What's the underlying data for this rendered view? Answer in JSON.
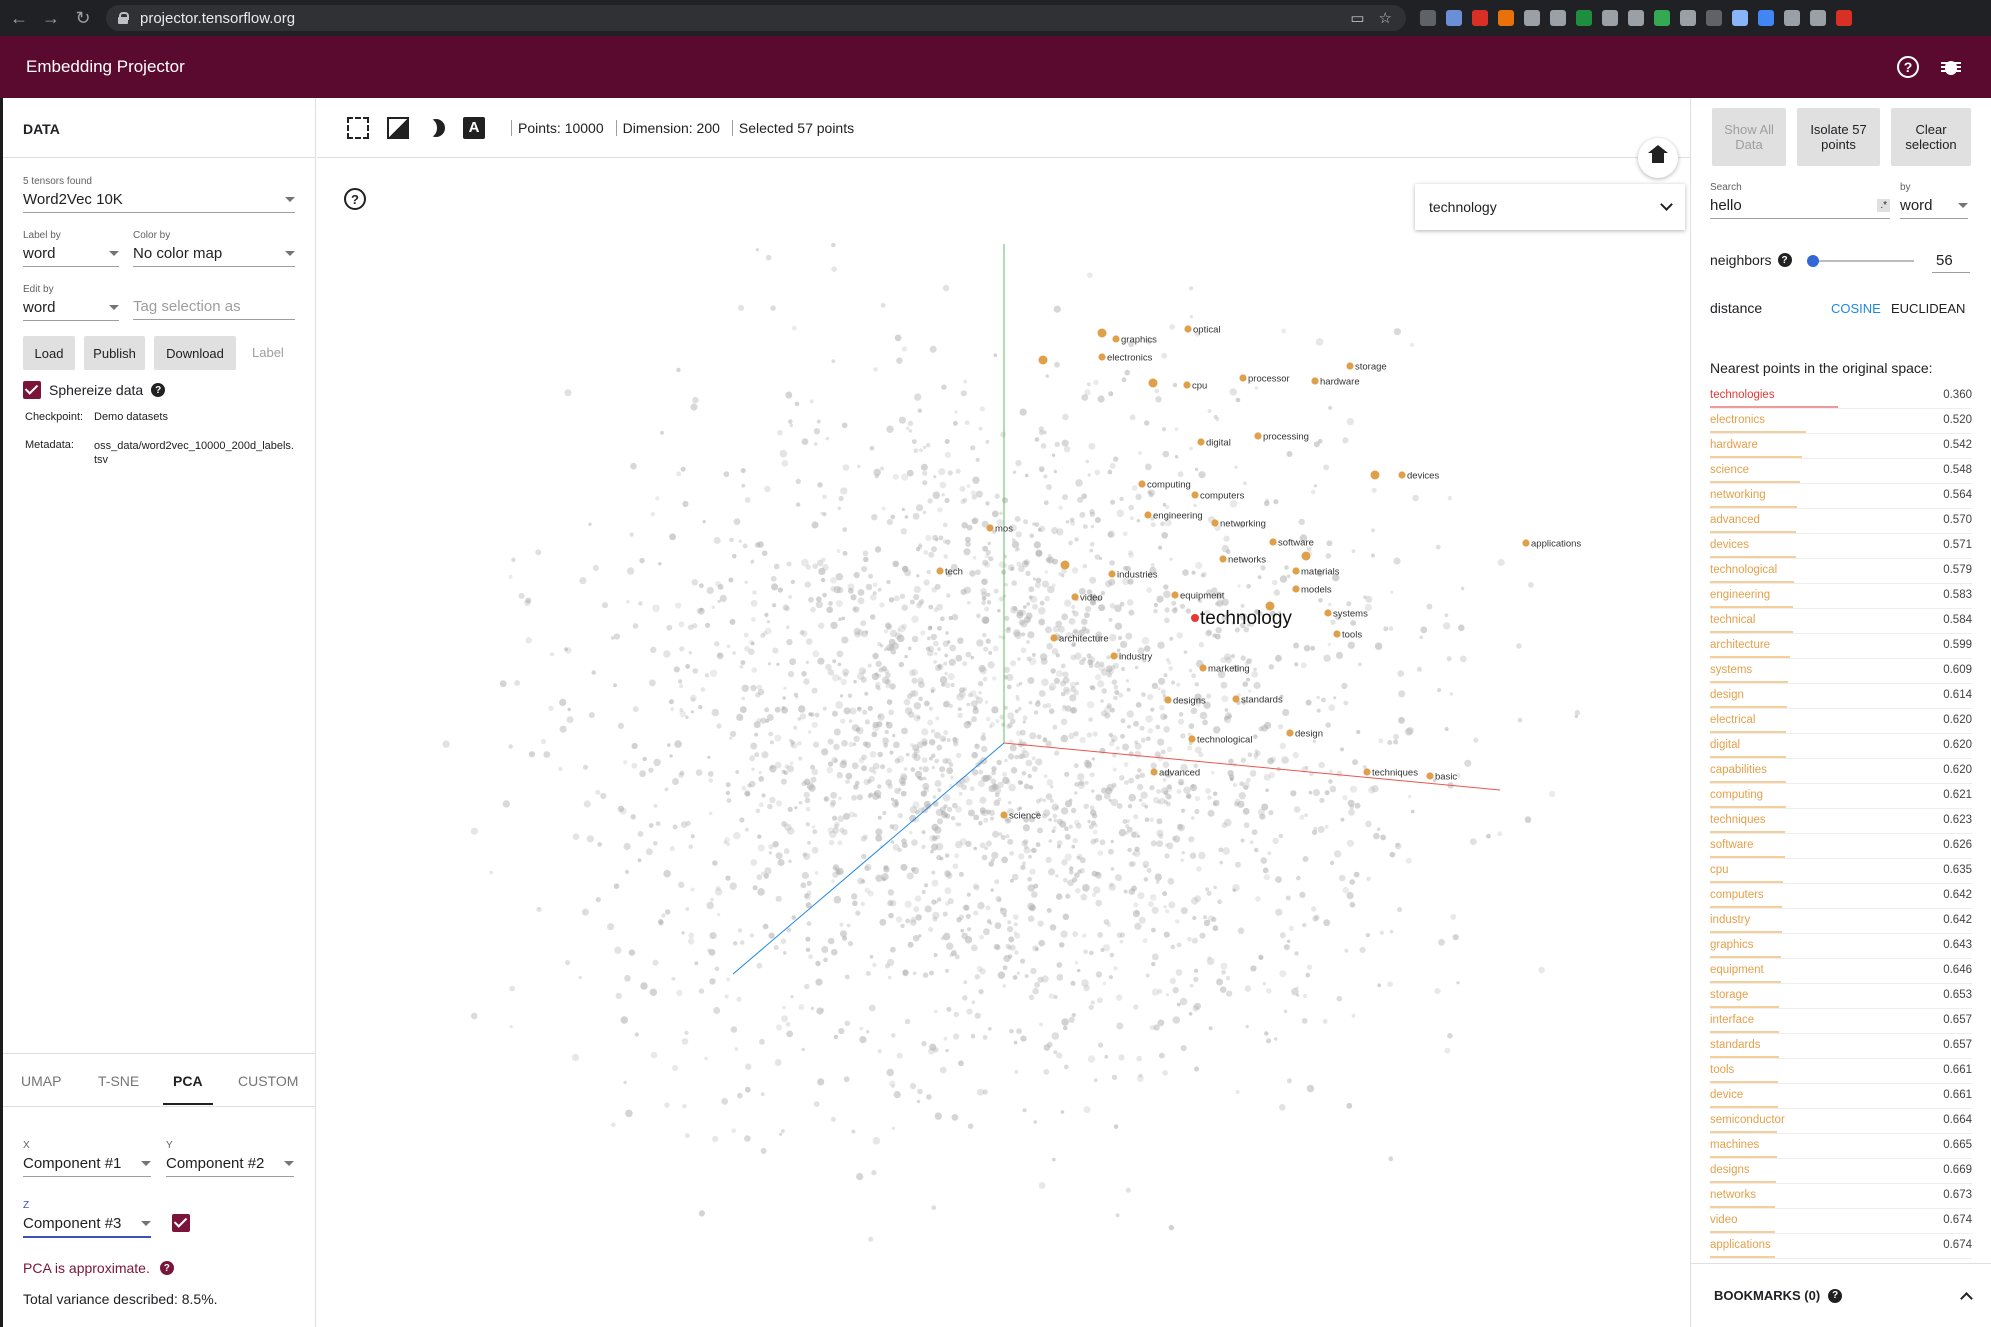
{
  "browser": {
    "url": "projector.tensorflow.org",
    "extension_colors": [
      "#5f6368",
      "#6b8fd6",
      "#d93025",
      "#e8710a",
      "#9aa0a6",
      "#9aa0a6",
      "#1e8e3e",
      "#9aa0a6",
      "#9aa0a6",
      "#34a853",
      "#9aa0a6",
      "#5f6368",
      "#8ab4f8",
      "#4285f4",
      "#9aa0a6",
      "#9aa0a6",
      "#d93025"
    ]
  },
  "header": {
    "title": "Embedding Projector"
  },
  "data_panel": {
    "title": "DATA",
    "tensors_label": "5 tensors found",
    "tensor": "Word2Vec 10K",
    "label_by_label": "Label by",
    "label_by": "word",
    "color_by_label": "Color by",
    "color_by": "No color map",
    "edit_by_label": "Edit by",
    "edit_by": "word",
    "tag_placeholder": "Tag selection as",
    "load": "Load",
    "publish": "Publish",
    "download": "Download",
    "label_btn": "Label",
    "sphereize": "Sphereize data",
    "checkpoint_key": "Checkpoint:",
    "checkpoint_val": "Demo datasets",
    "metadata_key": "Metadata:",
    "metadata_val": "oss_data/word2vec_10000_200d_labels.tsv"
  },
  "projection": {
    "tabs": [
      "UMAP",
      "T-SNE",
      "PCA",
      "CUSTOM"
    ],
    "active_tab": "PCA",
    "x_label": "X",
    "x_value": "Component #1",
    "y_label": "Y",
    "y_value": "Component #2",
    "z_label": "Z",
    "z_value": "Component #3",
    "approx_note": "PCA is approximate.",
    "variance": "Total variance described: 8.5%."
  },
  "toolbar": {
    "points": "Points: 10000",
    "dimension": "Dimension: 200",
    "selected": "Selected 57 points",
    "label_select": "technology"
  },
  "scatter": {
    "query_label": "technology",
    "query_color": "#e53935",
    "neighbor_color": "#e0a04a",
    "background_point_color": "#b0b0b0",
    "axis_colors": {
      "x": "#ef5350",
      "y": "#66bb6a",
      "z": "#1e88e5"
    },
    "labels": [
      "graphics",
      "optical",
      "electronics",
      "storage",
      "processor",
      "cpu",
      "hardware",
      "digital",
      "processing",
      "devices",
      "computing",
      "computers",
      "applications",
      "engineering",
      "networking",
      "mos",
      "software",
      "networks",
      "tech",
      "industries",
      "materials",
      "video",
      "equipment",
      "models",
      "systems",
      "architecture",
      "tools",
      "industry",
      "marketing",
      "designs",
      "standards",
      "technological",
      "design",
      "advanced",
      "techniques",
      "basic",
      "science"
    ]
  },
  "inspector": {
    "show_all": "Show All Data",
    "isolate": "Isolate 57 points",
    "clear": "Clear selection",
    "search_label": "Search",
    "search_value": "hello",
    "regex": ".*",
    "by_label": "by",
    "by_value": "word",
    "neighbors_label": "neighbors",
    "neighbors": "56",
    "neighbors_fraction": 0.01,
    "distance_label": "distance",
    "cosine": "COSINE",
    "euclidean": "EUCLIDEAN",
    "nearest_title": "Nearest points in the original space:",
    "nearest": [
      {
        "word": "technologies",
        "dist": "0.360"
      },
      {
        "word": "electronics",
        "dist": "0.520"
      },
      {
        "word": "hardware",
        "dist": "0.542"
      },
      {
        "word": "science",
        "dist": "0.548"
      },
      {
        "word": "networking",
        "dist": "0.564"
      },
      {
        "word": "advanced",
        "dist": "0.570"
      },
      {
        "word": "devices",
        "dist": "0.571"
      },
      {
        "word": "technological",
        "dist": "0.579"
      },
      {
        "word": "engineering",
        "dist": "0.583"
      },
      {
        "word": "technical",
        "dist": "0.584"
      },
      {
        "word": "architecture",
        "dist": "0.599"
      },
      {
        "word": "systems",
        "dist": "0.609"
      },
      {
        "word": "design",
        "dist": "0.614"
      },
      {
        "word": "electrical",
        "dist": "0.620"
      },
      {
        "word": "digital",
        "dist": "0.620"
      },
      {
        "word": "capabilities",
        "dist": "0.620"
      },
      {
        "word": "computing",
        "dist": "0.621"
      },
      {
        "word": "techniques",
        "dist": "0.623"
      },
      {
        "word": "software",
        "dist": "0.626"
      },
      {
        "word": "cpu",
        "dist": "0.635"
      },
      {
        "word": "computers",
        "dist": "0.642"
      },
      {
        "word": "industry",
        "dist": "0.642"
      },
      {
        "word": "graphics",
        "dist": "0.643"
      },
      {
        "word": "equipment",
        "dist": "0.646"
      },
      {
        "word": "storage",
        "dist": "0.653"
      },
      {
        "word": "interface",
        "dist": "0.657"
      },
      {
        "word": "standards",
        "dist": "0.657"
      },
      {
        "word": "tools",
        "dist": "0.661"
      },
      {
        "word": "device",
        "dist": "0.661"
      },
      {
        "word": "semiconductor",
        "dist": "0.664"
      },
      {
        "word": "machines",
        "dist": "0.665"
      },
      {
        "word": "designs",
        "dist": "0.669"
      },
      {
        "word": "networks",
        "dist": "0.673"
      },
      {
        "word": "video",
        "dist": "0.674"
      },
      {
        "word": "applications",
        "dist": "0.674"
      }
    ],
    "bookmarks": "BOOKMARKS (0)"
  }
}
